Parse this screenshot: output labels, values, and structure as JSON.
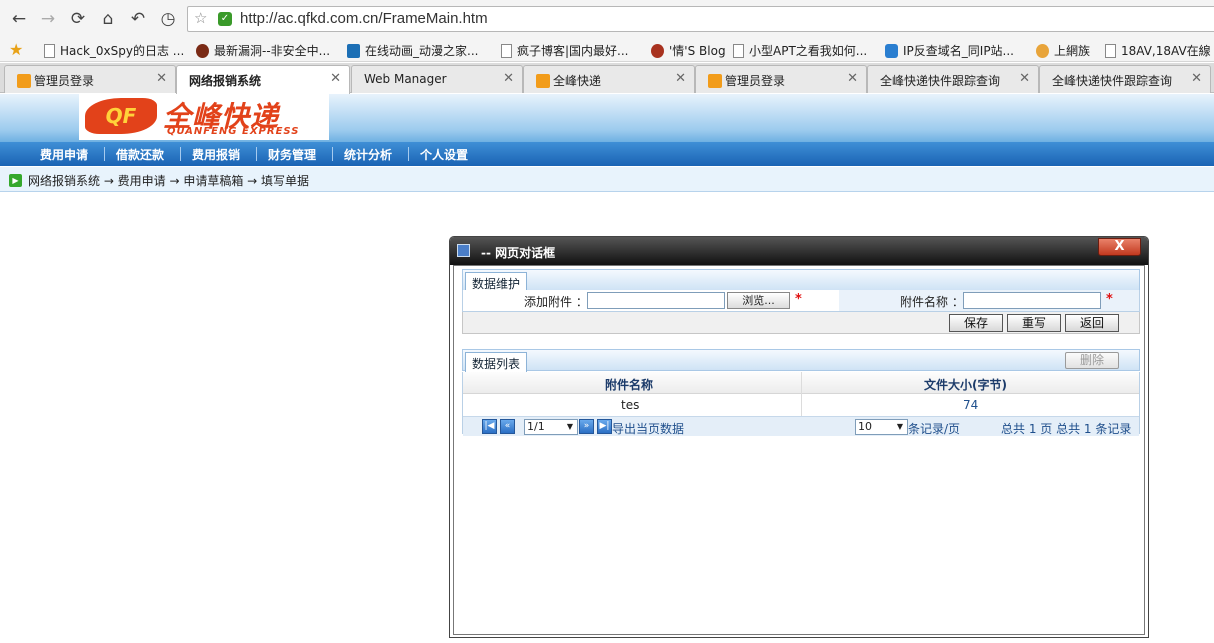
{
  "browser": {
    "url": "http://ac.qfkd.com.cn/FrameMain.htm",
    "bookmarks": [
      {
        "label": "Hack_0xSpy的日志 ...",
        "icon": "page-icon"
      },
      {
        "label": "最新漏洞--非安全中...",
        "icon": "bug-icon"
      },
      {
        "label": "在线动画_动漫之家...",
        "icon": "calendar-icon"
      },
      {
        "label": "疯子博客|国内最好...",
        "icon": "page-icon"
      },
      {
        "label": "'情'S Blog",
        "icon": "avatar-icon"
      },
      {
        "label": "小型APT之看我如何...",
        "icon": "page-icon"
      },
      {
        "label": "IP反查域名_同IP站...",
        "icon": "globe-icon"
      },
      {
        "label": "上網族",
        "icon": "pig-icon"
      },
      {
        "label": "18AV,18AV在線",
        "icon": "page-icon"
      }
    ],
    "tabs": [
      {
        "label": "管理员登录"
      },
      {
        "label": "网络报销系统"
      },
      {
        "label": "Web Manager"
      },
      {
        "label": "全峰快递"
      },
      {
        "label": "管理员登录"
      },
      {
        "label": "全峰快递快件跟踪查询"
      },
      {
        "label": "全峰快递快件跟踪查询"
      }
    ]
  },
  "app": {
    "logo_cn": "全峰快递",
    "logo_en": "QUANFENG EXPRESS",
    "menu": [
      "费用申请",
      "借款还款",
      "费用报销",
      "财务管理",
      "统计分析",
      "个人设置"
    ],
    "breadcrumb": "网络报销系统 → 费用申请 → 申请草稿箱 → 填写单据"
  },
  "dialog": {
    "title": "-- 网页对话框",
    "close_label": "X",
    "maintain_tab": "数据维护",
    "attachment_label": "添加附件 ：",
    "browse_label": "浏览...",
    "name_label": "附件名称 ：",
    "required_mark": "*",
    "save_label": "保存",
    "reset_label": "重写",
    "back_label": "返回",
    "list_tab": "数据列表",
    "delete_label": "删除",
    "columns": [
      "附件名称",
      "文件大小(字节)"
    ],
    "rows": [
      {
        "name": "tes",
        "size": "74"
      }
    ],
    "pager": {
      "page": "1/1",
      "export_label": "导出当页数据",
      "page_size": "10",
      "per_page_label": "条记录/页",
      "summary": "总共 1 页 总共 1 条记录"
    }
  }
}
